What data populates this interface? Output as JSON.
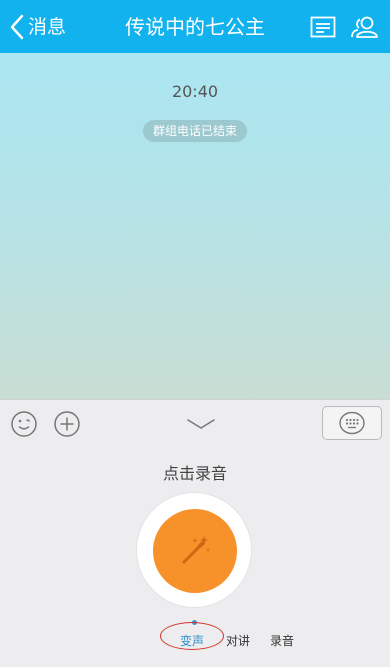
{
  "header": {
    "back_label": "消息",
    "title": "传说中的七公主"
  },
  "chat": {
    "timestamp": "20:40",
    "system_notice": "群组电话已结束"
  },
  "voice_panel": {
    "hint": "点击录音",
    "modes": [
      {
        "label": "变声",
        "selected": true
      },
      {
        "label": "对讲",
        "selected": false
      },
      {
        "label": "录音",
        "selected": false
      }
    ]
  },
  "colors": {
    "header_bg": "#12b2ef",
    "record_button": "#f7922b",
    "selected_mode": "#2f8fd0",
    "annotation_circle": "#d4322d"
  },
  "icons": [
    "chevron-left-icon",
    "profile-card-icon",
    "group-members-icon",
    "emoji-icon",
    "plus-icon",
    "chevron-down-icon",
    "keyboard-icon",
    "magic-wand-icon"
  ]
}
